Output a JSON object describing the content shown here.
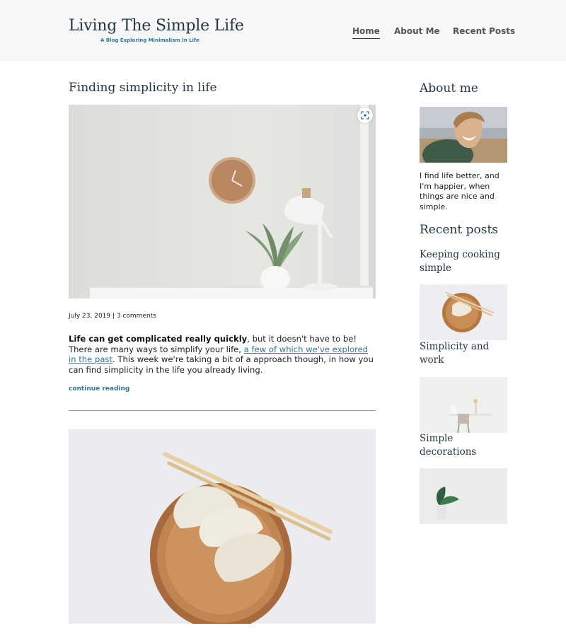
{
  "site": {
    "title": "Living The Simple Life",
    "tagline": "A Blog Exploring Minimalism In Life"
  },
  "nav": {
    "items": [
      {
        "label": "Home",
        "active": true
      },
      {
        "label": "About Me",
        "active": false
      },
      {
        "label": "Recent Posts",
        "active": false
      }
    ]
  },
  "post": {
    "title": "Finding simplicity in life",
    "meta": "July 23, 2019 | 3 comments",
    "excerpt": {
      "bold": "Life can get complicated really quickly",
      "text1": ", but it doesn't have to be! There are many ways to simplify your life, ",
      "link": "a few of which we've explored in the past",
      "text2": ". This week we're taking a bit of a approach though, in how you can find simplicity in the life you already living."
    },
    "continue_label": "continue reading",
    "hero_icon": "lens-icon"
  },
  "sidebar": {
    "about_heading": "About me",
    "about_text": "I find life better, and I'm happier, when things are nice and simple.",
    "recent_heading": "Recent posts",
    "recent_posts": [
      {
        "title": "Keeping cooking simple"
      },
      {
        "title": "Simplicity and work"
      },
      {
        "title": "Simple decorations"
      }
    ]
  },
  "colors": {
    "accent": "#2d7a99",
    "heading": "#243746",
    "header_bg": "#f7f7f7"
  }
}
